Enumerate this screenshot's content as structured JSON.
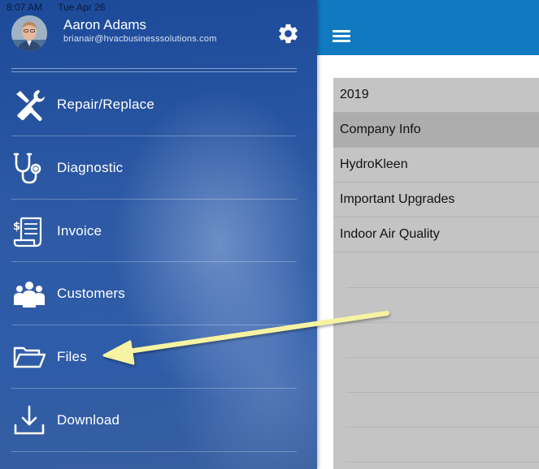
{
  "status_bar": {
    "time": "8:07 AM",
    "date": "Tue Apr 26"
  },
  "profile": {
    "name": "Aaron Adams",
    "email": "brianair@hvacbusinesssolutions.com"
  },
  "menu": [
    {
      "label": "Repair/Replace",
      "icon": "tools-icon"
    },
    {
      "label": "Diagnostic",
      "icon": "stethoscope-icon"
    },
    {
      "label": "Invoice",
      "icon": "invoice-icon"
    },
    {
      "label": "Customers",
      "icon": "people-icon"
    },
    {
      "label": "Files",
      "icon": "folder-icon"
    },
    {
      "label": "Download",
      "icon": "download-icon"
    }
  ],
  "files": [
    {
      "name": "2019",
      "selected": false
    },
    {
      "name": "Company Info",
      "selected": true
    },
    {
      "name": "HydroKleen",
      "selected": false
    },
    {
      "name": "Important Upgrades",
      "selected": false
    },
    {
      "name": "Indoor Air Quality",
      "selected": false
    }
  ],
  "colors": {
    "topbar": "#1079c0",
    "sidebar": "#2e5aa5",
    "list_bg": "#c4c4c4",
    "selected_row": "#adadad",
    "annotation_arrow": "#f6f3a2"
  }
}
